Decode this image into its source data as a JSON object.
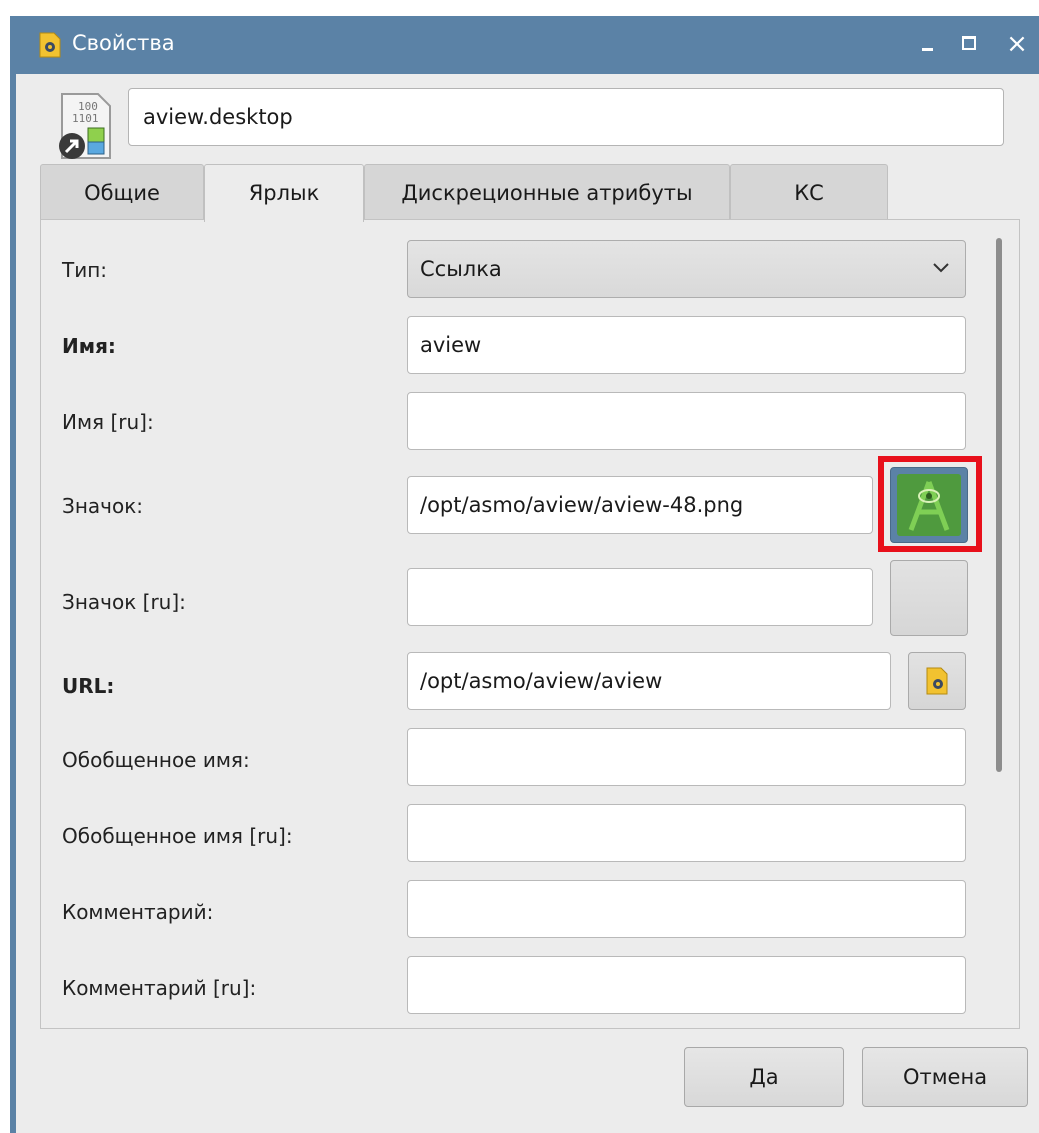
{
  "window": {
    "title": "Свойства",
    "controls": {
      "minimize": "_",
      "maximize": "□",
      "close": "×"
    }
  },
  "header": {
    "filename": "aview.desktop"
  },
  "tabs": [
    {
      "label": "Общие",
      "active": false
    },
    {
      "label": "Ярлык",
      "active": true
    },
    {
      "label": "Дискреционные атрибуты",
      "active": false
    },
    {
      "label": "КС",
      "active": false
    }
  ],
  "form": {
    "type": {
      "label": "Тип:",
      "value": "Ссылка"
    },
    "name": {
      "label": "Имя:",
      "value": "aview"
    },
    "name_ru": {
      "label": "Имя [ru]:",
      "value": ""
    },
    "icon": {
      "label": "Значок:",
      "value": "/opt/asmo/aview/aview-48.png"
    },
    "icon_ru": {
      "label": "Значок [ru]:",
      "value": ""
    },
    "url": {
      "label": "URL:",
      "value": "/opt/asmo/aview/aview"
    },
    "generic_name": {
      "label": "Обобщенное имя:",
      "value": ""
    },
    "generic_name_ru": {
      "label": "Обобщенное имя [ru]:",
      "value": ""
    },
    "comment": {
      "label": "Комментарий:",
      "value": ""
    },
    "comment_ru": {
      "label": "Комментарий [ru]:",
      "value": ""
    }
  },
  "buttons": {
    "ok": "Да",
    "cancel": "Отмена"
  },
  "colors": {
    "titlebar": "#5b82a6",
    "highlight": "#e8101b",
    "icon_green": "#4f9a3e"
  },
  "icons": {
    "title": "settings-file-icon",
    "file": "desktop-shortcut-file-icon",
    "icon_preview": "aview-app-icon",
    "url_browse": "settings-file-icon"
  }
}
